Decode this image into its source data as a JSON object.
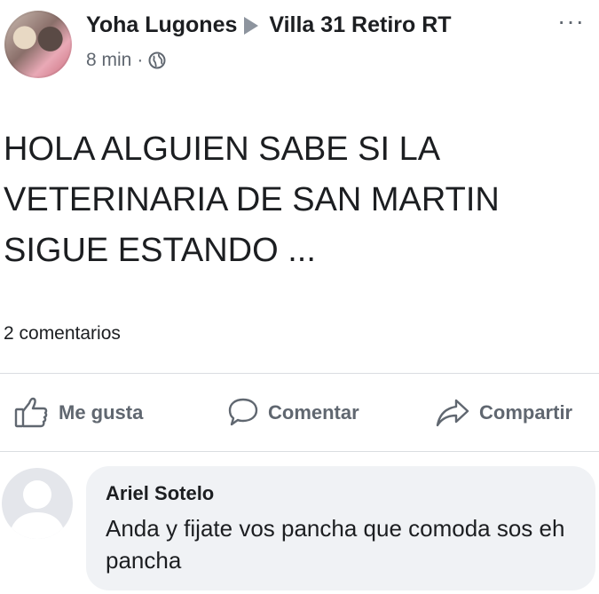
{
  "post": {
    "author": "Yoha Lugones",
    "group": "Villa 31 Retiro RT",
    "time": "8 min",
    "separator": "·",
    "more_label": "···",
    "text": "HOLA ALGUIEN  SABE SI LA\nVETERINARIA DE SAN MARTIN\nSIGUE ESTANDO ...",
    "comments_count": "2 comentarios"
  },
  "actions": {
    "like_label": "Me gusta",
    "comment_label": "Comentar",
    "share_label": "Compartir"
  },
  "comment": {
    "author": "Ariel Sotelo",
    "text": "Anda y fijate vos pancha que comoda sos  eh pancha"
  },
  "icons": {
    "like": "thumbs-up-icon",
    "comment": "speech-bubble-icon",
    "share": "share-arrow-icon",
    "privacy": "globe-icon",
    "more": "more-horizontal-icon"
  },
  "colors": {
    "text": "#1c1e21",
    "secondary": "#606770",
    "divider": "#dadde1",
    "bubble": "#f0f2f5"
  }
}
